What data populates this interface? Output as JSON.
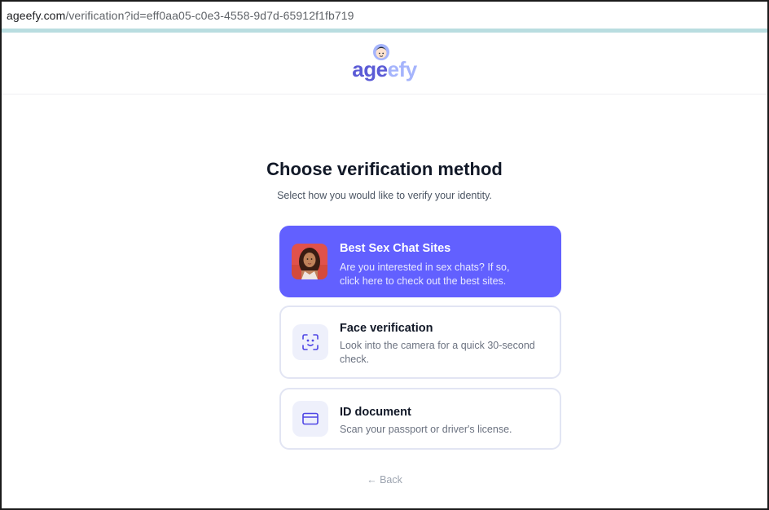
{
  "browser": {
    "url_domain": "ageefy.com",
    "url_path": "/verification?id=eff0aa05-c0e3-4558-9d7d-65912f1fb719"
  },
  "header": {
    "logo_part1": "age",
    "logo_part2": "efy",
    "logo_icon": "mascot-face-icon"
  },
  "main": {
    "title": "Choose verification method",
    "subtitle": "Select how you would like to verify your identity.",
    "options": [
      {
        "title": "Best Sex Chat Sites",
        "desc_line1": "Are you interested in sex chats? If so,",
        "desc_line2": "click here to check out the best sites.",
        "icon": "promo-thumbnail"
      },
      {
        "title": "Face verification",
        "desc_line1": "Look into the camera for a quick 30-second",
        "desc_line2": "check.",
        "icon": "face-scan-icon"
      },
      {
        "title": "ID document",
        "desc_line1": "Scan your passport or driver's license.",
        "icon": "id-card-icon"
      }
    ],
    "back_label": "← Back"
  },
  "colors": {
    "accent": "#6260ff",
    "logo_dark": "#5b5bd6",
    "logo_light": "#a5b4fc",
    "card_border": "#e2e5f3",
    "icon_bg": "#eef0fb"
  }
}
